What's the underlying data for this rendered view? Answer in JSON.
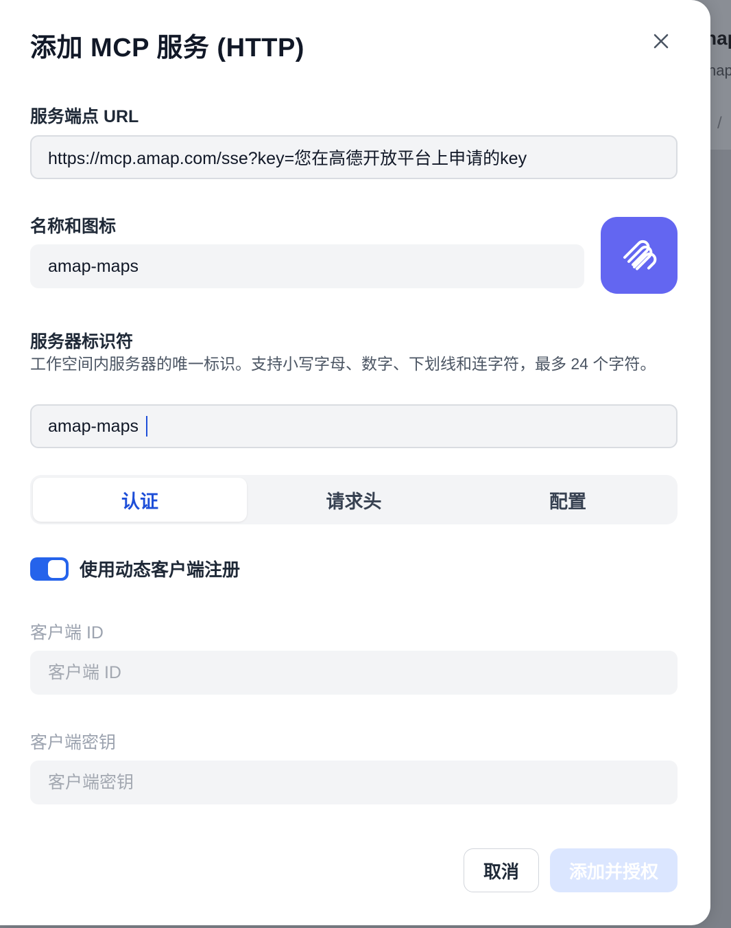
{
  "background_app": {
    "text1": "nap",
    "text2": "nap",
    "text3": "/"
  },
  "dialog": {
    "title": "添加 MCP 服务 (HTTP)",
    "close_icon": "close-icon"
  },
  "endpoint": {
    "label": "服务端点 URL",
    "value": "https://mcp.amap.com/sse?key=您在高德开放平台上申请的key"
  },
  "name_icon": {
    "label": "名称和图标",
    "value": "amap-maps",
    "icon": "paperclip-icon",
    "icon_bg": "#6366f1"
  },
  "identifier": {
    "label": "服务器标识符",
    "helper": "工作空间内服务器的唯一标识。支持小写字母、数字、下划线和连字符，最多 24 个字符。",
    "value": "amap-maps"
  },
  "tabs": [
    {
      "label": "认证",
      "active": true
    },
    {
      "label": "请求头",
      "active": false
    },
    {
      "label": "配置",
      "active": false
    }
  ],
  "dynamic_registration": {
    "label": "使用动态客户端注册",
    "enabled": true
  },
  "client_id": {
    "label": "客户端 ID",
    "placeholder": "客户端 ID"
  },
  "client_secret": {
    "label": "客户端密钥",
    "placeholder": "客户端密钥"
  },
  "actions": {
    "cancel": "取消",
    "submit": "添加并授权"
  },
  "colors": {
    "accent": "#2563eb",
    "submit_disabled_bg": "#dbe6ff"
  }
}
